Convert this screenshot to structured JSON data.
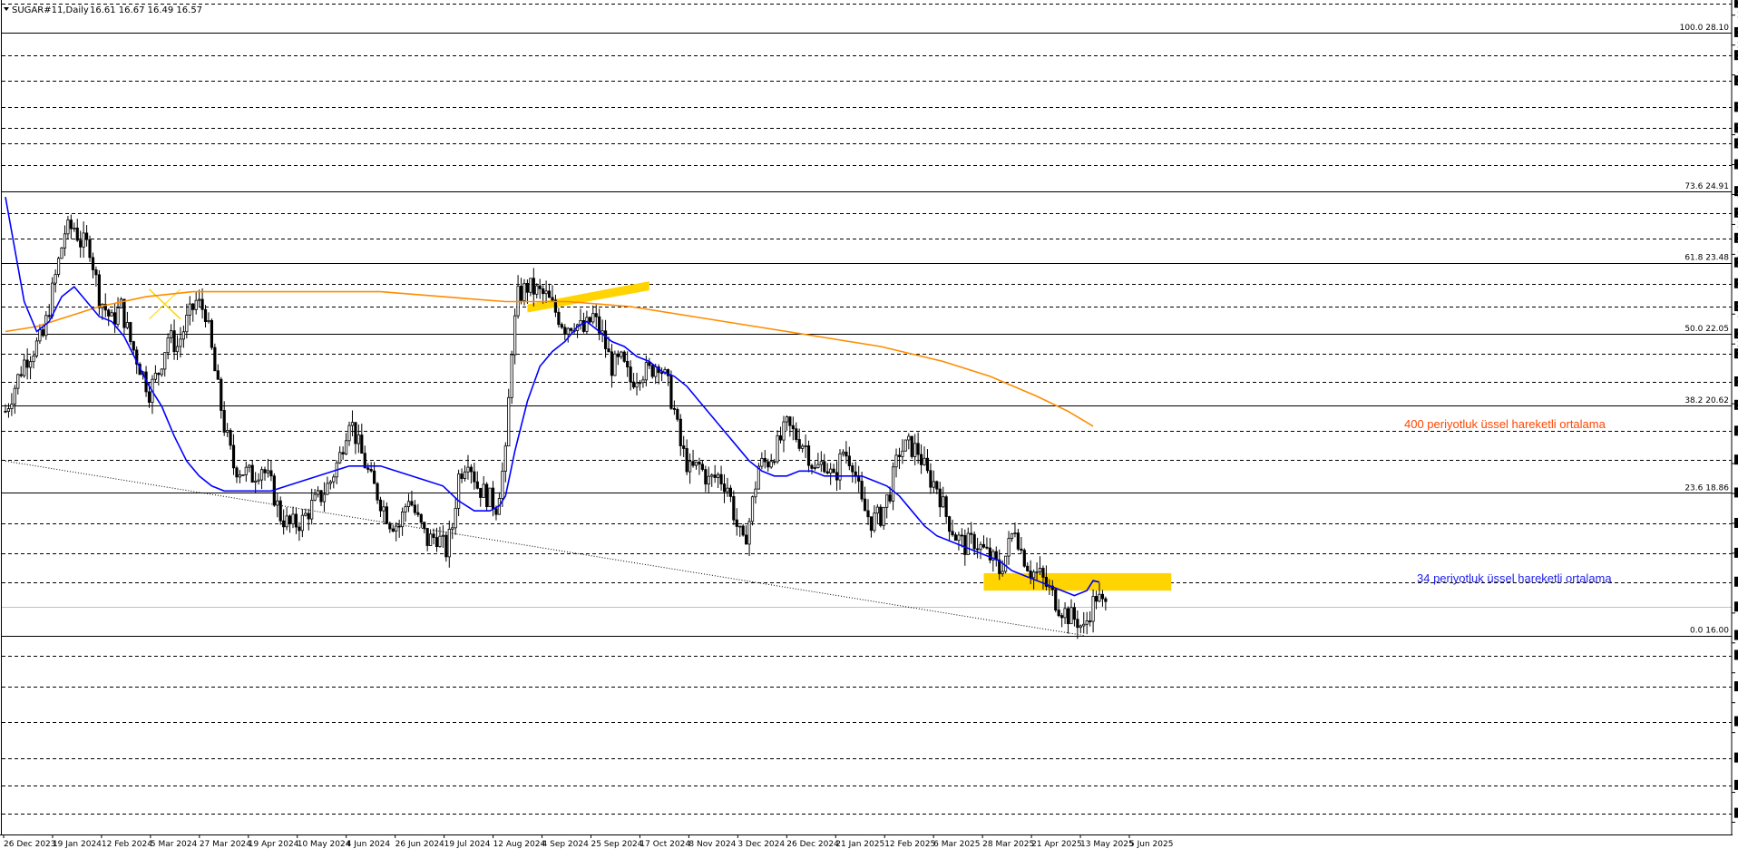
{
  "chart_data": {
    "type": "candlestick",
    "symbol_header": "SUGAR#11,Daily",
    "ohlc_header": "16.61 16.67 16.49 16.57",
    "colors": {
      "background": "#ffffff",
      "candle": "#000000",
      "grid": "#000000",
      "ema34": "#0000ff",
      "ema400": "#ff8c00",
      "zone": "#ffd400",
      "price_bubble": "#000000",
      "ann_ema400": "#ff4500",
      "ann_ema34": "#1e1ef0"
    },
    "y_range": [
      12.15,
      28.7
    ],
    "y_scale_ticks": [
      "28.45",
      "27.85",
      "27.25",
      "26.05",
      "25.45",
      "24.85",
      "24.25",
      "23.65",
      "22.45",
      "21.85",
      "20.65",
      "19.45",
      "18.85",
      "18.25",
      "17.65",
      "16.45",
      "15.85",
      "15.25",
      "14.65",
      "14.05",
      "12.85",
      "12.25"
    ],
    "level_lines": [
      {
        "value": "28.69",
        "style": "dashed",
        "label": ""
      },
      {
        "value": "28.10",
        "style": "solid",
        "label": "100.0 28.10"
      },
      {
        "value": "27.64",
        "style": "dashed",
        "label": ""
      },
      {
        "value": "27.13",
        "style": "dashed",
        "label": ""
      },
      {
        "value": "26.60",
        "style": "dashed",
        "label": ""
      },
      {
        "value": "26.18",
        "style": "dashed",
        "label": ""
      },
      {
        "value": "25.87",
        "style": "dashed",
        "label": ""
      },
      {
        "value": "25.45",
        "style": "dashed",
        "label": ""
      },
      {
        "value": "24.91",
        "style": "solid",
        "label": "73.6 24.91"
      },
      {
        "value": "24.48",
        "style": "dashed",
        "label": ""
      },
      {
        "value": "23.97",
        "style": "dashed",
        "label": ""
      },
      {
        "value": "23.48",
        "style": "solid",
        "label": "61.8 23.48"
      },
      {
        "value": "23.06",
        "style": "dashed",
        "label": ""
      },
      {
        "value": "22.60",
        "style": "dashed",
        "label": ""
      },
      {
        "value": "22.05",
        "style": "solid",
        "label": "50.0 22.05"
      },
      {
        "value": "21.65",
        "style": "dashed",
        "label": ""
      },
      {
        "value": "21.09",
        "style": "dashed",
        "label": ""
      },
      {
        "value": "20.62",
        "style": "solid",
        "label": "38.2 20.62"
      },
      {
        "value": "20.10",
        "style": "dashed",
        "label": ""
      },
      {
        "value": "19.52",
        "style": "dashed",
        "label": ""
      },
      {
        "value": "18.86",
        "style": "solid",
        "label": "23.6 18.86"
      },
      {
        "value": "18.25",
        "style": "dashed",
        "label": ""
      },
      {
        "value": "17.65",
        "style": "dashed",
        "label": ""
      },
      {
        "value": "17.07",
        "style": "dashed",
        "label": ""
      },
      {
        "value": "16.57",
        "style": "current",
        "label": ""
      },
      {
        "value": "16.00",
        "style": "solid",
        "label": "0.0 16.00"
      },
      {
        "value": "15.60",
        "style": "dashed",
        "label": ""
      },
      {
        "value": "14.97",
        "style": "dashed",
        "label": ""
      },
      {
        "value": "14.27",
        "style": "dashed",
        "label": ""
      },
      {
        "value": "13.54",
        "style": "dashed",
        "label": ""
      },
      {
        "value": "12.99",
        "style": "dashed",
        "label": ""
      },
      {
        "value": "12.43",
        "style": "dashed",
        "label": ""
      }
    ],
    "x_labels": [
      "26 Dec 2023",
      "19 Jan 2024",
      "12 Feb 2024",
      "5 Mar 2024",
      "27 Mar 2024",
      "19 Apr 2024",
      "10 May 2024",
      "4 Jun 2024",
      "26 Jun 2024",
      "19 Jul 2024",
      "12 Aug 2024",
      "4 Sep 2024",
      "25 Sep 2024",
      "17 Oct 2024",
      "8 Nov 2024",
      "3 Dec 2024",
      "26 Dec 2024",
      "21 Jan 2025",
      "12 Feb 2025",
      "6 Mar 2025",
      "28 Mar 2025",
      "21 Apr 2025",
      "13 May 2025",
      "5 Jun 2025"
    ],
    "close_path": [
      [
        0,
        20.5
      ],
      [
        6,
        21.5
      ],
      [
        12,
        22.0
      ],
      [
        16,
        23.2
      ],
      [
        19,
        24.1
      ],
      [
        22,
        24.2
      ],
      [
        24,
        23.9
      ],
      [
        27,
        23.8
      ],
      [
        30,
        22.8
      ],
      [
        34,
        22.3
      ],
      [
        37,
        22.6
      ],
      [
        40,
        21.9
      ],
      [
        43,
        21.4
      ],
      [
        46,
        20.9
      ],
      [
        49,
        21.3
      ],
      [
        52,
        22.0
      ],
      [
        55,
        21.8
      ],
      [
        58,
        22.3
      ],
      [
        61,
        22.7
      ],
      [
        64,
        22.5
      ],
      [
        67,
        21.3
      ],
      [
        70,
        20.2
      ],
      [
        73,
        19.4
      ],
      [
        76,
        19.3
      ],
      [
        79,
        19.2
      ],
      [
        82,
        19.4
      ],
      [
        85,
        19.0
      ],
      [
        88,
        18.4
      ],
      [
        91,
        18.2
      ],
      [
        95,
        18.3
      ],
      [
        98,
        18.6
      ],
      [
        101,
        18.8
      ],
      [
        104,
        19.1
      ],
      [
        107,
        19.6
      ],
      [
        110,
        20.4
      ],
      [
        113,
        19.8
      ],
      [
        117,
        19.1
      ],
      [
        120,
        18.7
      ],
      [
        123,
        18.3
      ],
      [
        126,
        18.2
      ],
      [
        129,
        18.8
      ],
      [
        132,
        18.3
      ],
      [
        135,
        17.9
      ],
      [
        138,
        18.0
      ],
      [
        141,
        17.7
      ],
      [
        143,
        18.2
      ],
      [
        145,
        19.2
      ],
      [
        148,
        19.6
      ],
      [
        151,
        19.0
      ],
      [
        154,
        18.8
      ],
      [
        157,
        18.6
      ],
      [
        160,
        19.6
      ],
      [
        162,
        21.8
      ],
      [
        164,
        22.8
      ],
      [
        167,
        23.0
      ],
      [
        170,
        22.9
      ],
      [
        173,
        22.8
      ],
      [
        176,
        22.5
      ],
      [
        179,
        22.2
      ],
      [
        182,
        22.3
      ],
      [
        185,
        22.1
      ],
      [
        188,
        22.4
      ],
      [
        191,
        22.0
      ],
      [
        194,
        21.4
      ],
      [
        197,
        21.5
      ],
      [
        200,
        21.1
      ],
      [
        203,
        21.3
      ],
      [
        206,
        21.3
      ],
      [
        209,
        21.5
      ],
      [
        212,
        21.0
      ],
      [
        214,
        20.5
      ],
      [
        216,
        19.8
      ],
      [
        219,
        19.3
      ],
      [
        222,
        19.4
      ],
      [
        225,
        19.1
      ],
      [
        228,
        19.2
      ],
      [
        231,
        19.0
      ],
      [
        234,
        18.2
      ],
      [
        236,
        17.8
      ],
      [
        238,
        18.3
      ],
      [
        241,
        19.4
      ],
      [
        244,
        19.5
      ],
      [
        247,
        19.8
      ],
      [
        250,
        20.2
      ],
      [
        253,
        20.0
      ],
      [
        256,
        19.8
      ],
      [
        259,
        19.3
      ],
      [
        262,
        19.5
      ],
      [
        265,
        19.1
      ],
      [
        268,
        19.7
      ],
      [
        271,
        19.5
      ],
      [
        274,
        18.6
      ],
      [
        277,
        18.3
      ],
      [
        280,
        18.4
      ],
      [
        283,
        18.9
      ],
      [
        286,
        19.7
      ],
      [
        289,
        19.8
      ],
      [
        292,
        19.7
      ],
      [
        295,
        19.2
      ],
      [
        298,
        19.0
      ],
      [
        301,
        18.4
      ],
      [
        304,
        18.0
      ],
      [
        307,
        17.8
      ],
      [
        310,
        17.9
      ],
      [
        313,
        17.7
      ],
      [
        316,
        17.5
      ],
      [
        318,
        17.3
      ],
      [
        320,
        17.6
      ],
      [
        323,
        18.2
      ],
      [
        325,
        17.7
      ],
      [
        328,
        17.3
      ],
      [
        331,
        17.2
      ],
      [
        334,
        16.9
      ],
      [
        337,
        16.6
      ],
      [
        340,
        16.4
      ],
      [
        343,
        16.3
      ],
      [
        345,
        16.1
      ],
      [
        347,
        16.5
      ],
      [
        349,
        16.8
      ],
      [
        351,
        16.6
      ],
      [
        352,
        16.57
      ]
    ],
    "total_bars": 360,
    "ema34_path": [
      [
        0,
        24.8
      ],
      [
        6,
        22.7
      ],
      [
        10,
        22.1
      ],
      [
        14,
        22.3
      ],
      [
        18,
        22.8
      ],
      [
        22,
        23.0
      ],
      [
        26,
        22.7
      ],
      [
        30,
        22.4
      ],
      [
        34,
        22.3
      ],
      [
        38,
        22.0
      ],
      [
        42,
        21.5
      ],
      [
        46,
        21.0
      ],
      [
        50,
        20.6
      ],
      [
        54,
        20.0
      ],
      [
        58,
        19.5
      ],
      [
        62,
        19.2
      ],
      [
        66,
        19.0
      ],
      [
        70,
        18.9
      ],
      [
        75,
        18.9
      ],
      [
        80,
        18.9
      ],
      [
        85,
        18.9
      ],
      [
        90,
        19.0
      ],
      [
        95,
        19.1
      ],
      [
        100,
        19.2
      ],
      [
        105,
        19.3
      ],
      [
        110,
        19.4
      ],
      [
        115,
        19.4
      ],
      [
        120,
        19.4
      ],
      [
        125,
        19.3
      ],
      [
        130,
        19.2
      ],
      [
        135,
        19.1
      ],
      [
        140,
        19.0
      ],
      [
        145,
        18.7
      ],
      [
        150,
        18.5
      ],
      [
        155,
        18.5
      ],
      [
        158,
        18.6
      ],
      [
        160,
        18.8
      ],
      [
        163,
        19.7
      ],
      [
        167,
        20.7
      ],
      [
        171,
        21.4
      ],
      [
        175,
        21.7
      ],
      [
        179,
        21.9
      ],
      [
        183,
        22.2
      ],
      [
        186,
        22.3
      ],
      [
        190,
        22.1
      ],
      [
        194,
        21.9
      ],
      [
        198,
        21.8
      ],
      [
        202,
        21.6
      ],
      [
        206,
        21.5
      ],
      [
        210,
        21.3
      ],
      [
        214,
        21.2
      ],
      [
        218,
        21.0
      ],
      [
        222,
        20.7
      ],
      [
        226,
        20.4
      ],
      [
        230,
        20.1
      ],
      [
        234,
        19.8
      ],
      [
        238,
        19.5
      ],
      [
        242,
        19.3
      ],
      [
        246,
        19.2
      ],
      [
        250,
        19.2
      ],
      [
        254,
        19.3
      ],
      [
        258,
        19.3
      ],
      [
        262,
        19.2
      ],
      [
        266,
        19.2
      ],
      [
        270,
        19.2
      ],
      [
        274,
        19.2
      ],
      [
        278,
        19.1
      ],
      [
        282,
        19.0
      ],
      [
        286,
        18.8
      ],
      [
        290,
        18.5
      ],
      [
        294,
        18.2
      ],
      [
        298,
        18.0
      ],
      [
        302,
        17.9
      ],
      [
        306,
        17.8
      ],
      [
        310,
        17.7
      ],
      [
        314,
        17.6
      ],
      [
        318,
        17.5
      ],
      [
        322,
        17.3
      ],
      [
        326,
        17.2
      ],
      [
        330,
        17.1
      ],
      [
        334,
        17.0
      ],
      [
        338,
        16.9
      ],
      [
        342,
        16.8
      ],
      [
        346,
        16.9
      ],
      [
        348,
        17.1
      ],
      [
        350,
        17.07
      ]
    ],
    "ema400_path": [
      [
        0,
        22.1
      ],
      [
        10,
        22.2
      ],
      [
        20,
        22.4
      ],
      [
        30,
        22.6
      ],
      [
        45,
        22.8
      ],
      [
        60,
        22.9
      ],
      [
        80,
        22.9
      ],
      [
        100,
        22.9
      ],
      [
        120,
        22.9
      ],
      [
        140,
        22.8
      ],
      [
        160,
        22.7
      ],
      [
        180,
        22.7
      ],
      [
        200,
        22.6
      ],
      [
        220,
        22.4
      ],
      [
        240,
        22.2
      ],
      [
        260,
        22.0
      ],
      [
        280,
        21.8
      ],
      [
        300,
        21.5
      ],
      [
        315,
        21.2
      ],
      [
        330,
        20.8
      ],
      [
        340,
        20.5
      ],
      [
        348,
        20.2
      ]
    ],
    "fib_levels": [
      {
        "pct": "100.0",
        "value": 28.1
      },
      {
        "pct": "73.6",
        "value": 24.91
      },
      {
        "pct": "61.8",
        "value": 23.48
      },
      {
        "pct": "50.0",
        "value": 22.05
      },
      {
        "pct": "38.2",
        "value": 20.62
      },
      {
        "pct": "23.6",
        "value": 18.86
      },
      {
        "pct": "0.0",
        "value": 16.0
      }
    ],
    "trendline": [
      [
        0,
        19.5
      ],
      [
        345,
        16.0
      ]
    ],
    "zones": [
      {
        "x0": 167,
        "x1": 206,
        "y_top": 23.0,
        "y_bot": 22.7,
        "skew": true
      },
      {
        "x0": 313,
        "x1": 373,
        "y_top": 17.25,
        "y_bot": 16.9,
        "skew": false
      }
    ],
    "annotations": [
      {
        "id": "ema400",
        "text": "400 periyotluk üssel hareketli ortalama"
      },
      {
        "id": "ema34",
        "text": "34 periyotluk üssel hareketli ortalama"
      }
    ]
  }
}
